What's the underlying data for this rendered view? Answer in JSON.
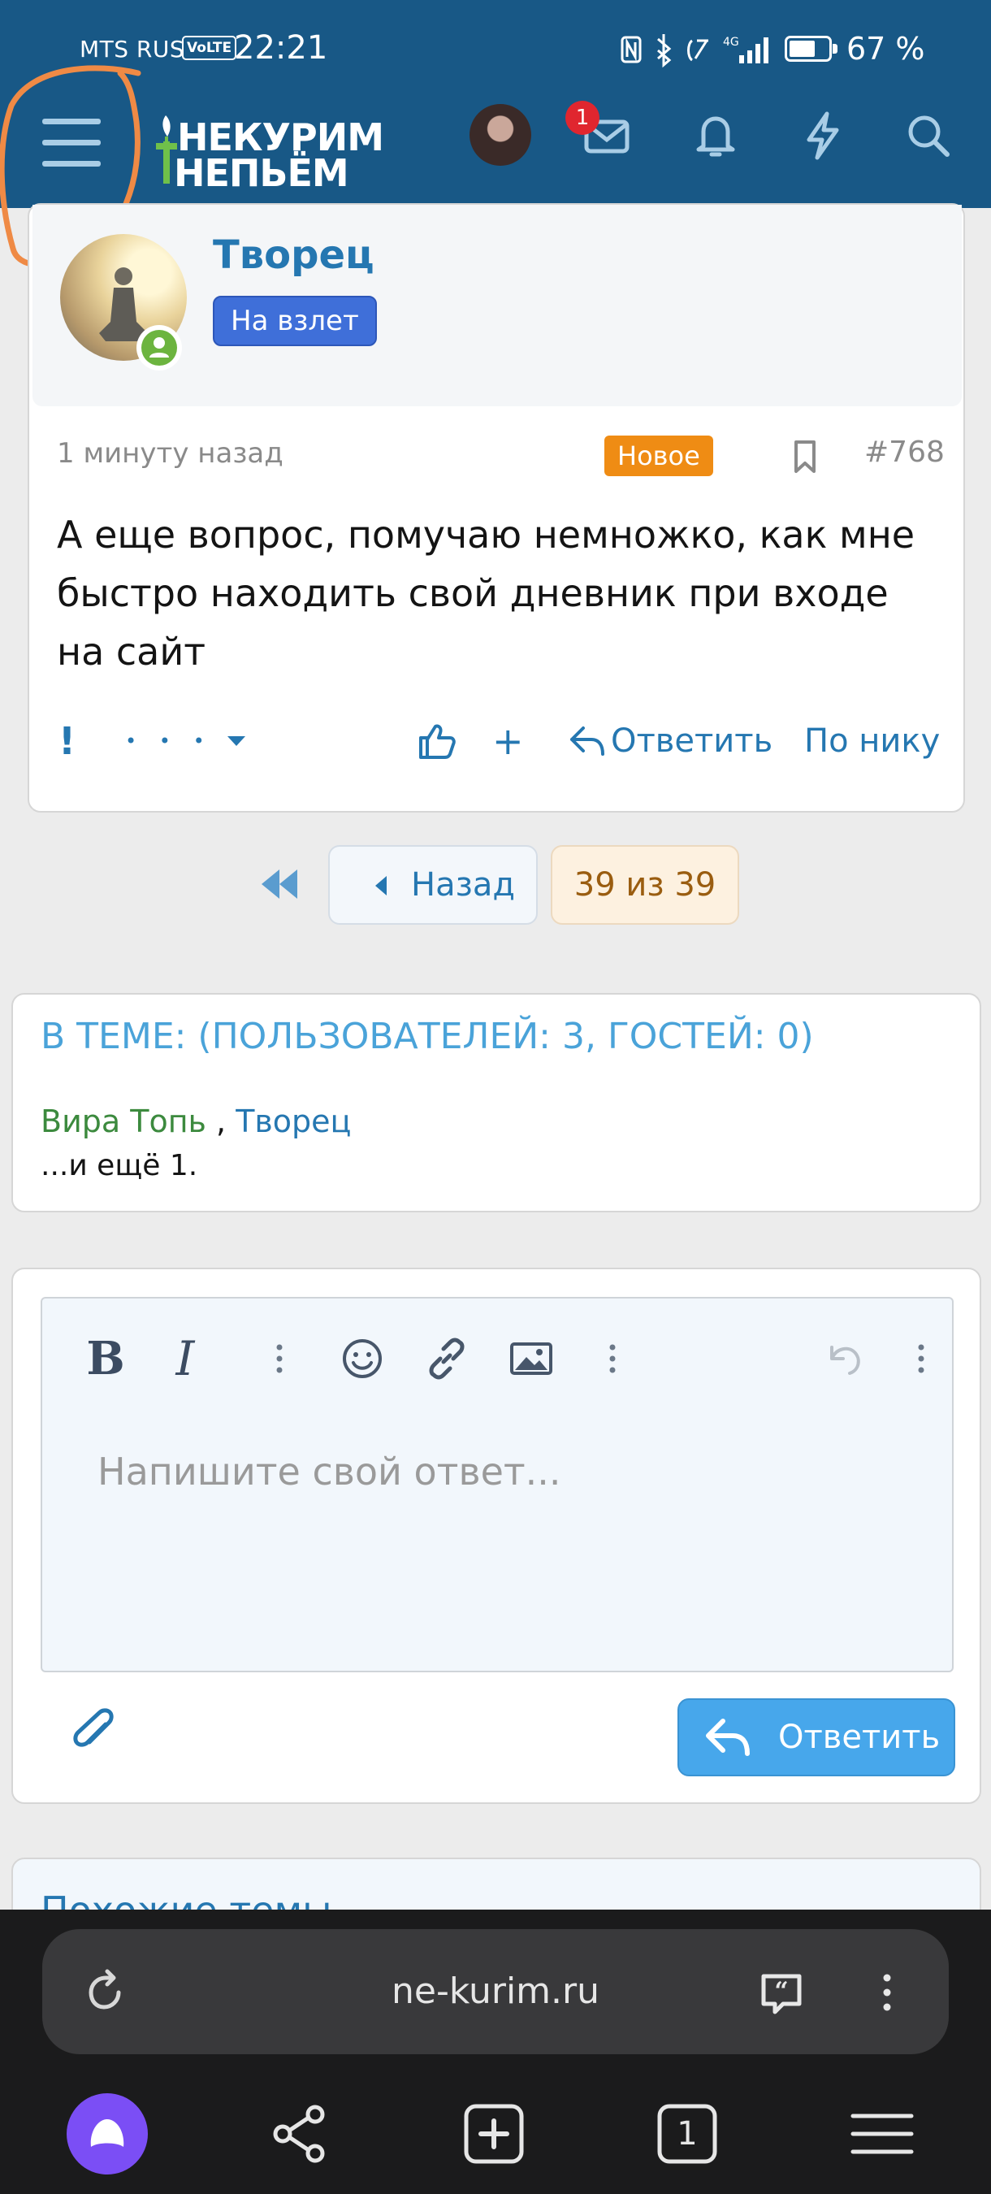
{
  "status_bar": {
    "carrier": "MTS RUS",
    "volte": "VoLTE",
    "time": "22:21",
    "network": "4G",
    "battery_level": 0.67,
    "battery_text": "67 %"
  },
  "header": {
    "logo_line1": "НЕКУРИМ",
    "logo_line2": "НЕПЬЁМ",
    "messages_badge": "1",
    "icons": [
      "menu-icon",
      "avatar",
      "envelope-icon",
      "bell-icon",
      "lightning-icon",
      "search-icon"
    ]
  },
  "post": {
    "author": "Творец",
    "user_title": "На взлет",
    "time": "1 минуту назад",
    "new_label": "Новое",
    "number": "#768",
    "text": "А еще вопрос, помучаю немножко, как мне быстро находить свой дневник при входе на сайт",
    "actions": {
      "report": "!",
      "more": "• • •",
      "add": "+",
      "reply": "Ответить",
      "by_nick": "По нику"
    }
  },
  "pagination": {
    "back": "Назад",
    "current": "39 из 39"
  },
  "online_block": {
    "title": "В ТЕМЕ: (ПОЛЬЗОВАТЕЛЕЙ: 3, ГОСТЕЙ: 0)",
    "user1": "Вира Топь",
    "separator": " , ",
    "user2": "Творец",
    "more": "...и ещё 1."
  },
  "reply_editor": {
    "bold": "B",
    "italic": "I",
    "placeholder": "Напишите свой ответ...",
    "submit": "Ответить"
  },
  "similar": {
    "title": "Похожие темы"
  },
  "browser": {
    "url": "ne-kurim.ru",
    "tabs_count": "1"
  },
  "colors": {
    "header_bg": "#185886",
    "link": "#2577b1",
    "new_badge": "#ef8c14",
    "user_title_bg": "#3f6fd9",
    "online_user": "#3c8a3e",
    "send_button": "#47a7eb"
  }
}
